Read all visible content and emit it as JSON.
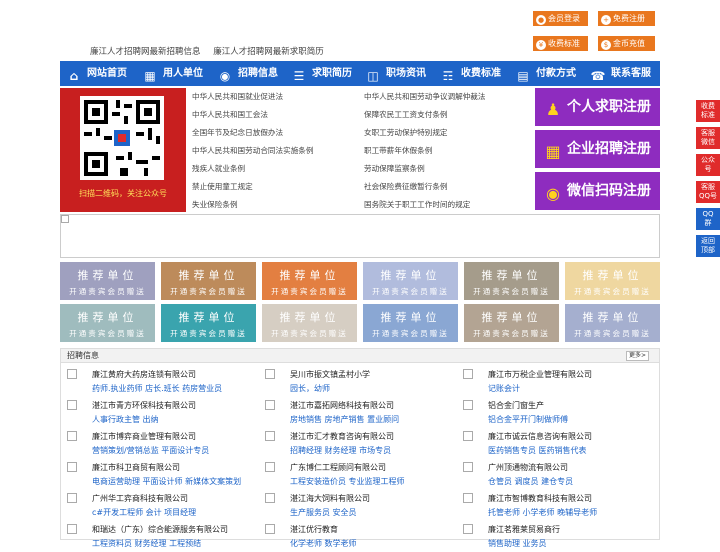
{
  "top_buttons": [
    {
      "label": "会员登录",
      "icon": "user-icon"
    },
    {
      "label": "免费注册",
      "icon": "user-add-icon"
    },
    {
      "label": "收费标准",
      "icon": "tag-icon"
    },
    {
      "label": "金币充值",
      "icon": "coin-icon"
    }
  ],
  "header_links": [
    "廉江人才招聘网最新招聘信息",
    "廉江人才招聘网最新求职简历"
  ],
  "nav": [
    {
      "label": "网站首页",
      "icon": "home-icon"
    },
    {
      "label": "用人单位",
      "icon": "building-icon"
    },
    {
      "label": "招聘信息",
      "icon": "megaphone-icon"
    },
    {
      "label": "求职简历",
      "icon": "resume-icon"
    },
    {
      "label": "职场资讯",
      "icon": "news-icon"
    },
    {
      "label": "收费标准",
      "icon": "fee-icon"
    },
    {
      "label": "付款方式",
      "icon": "payment-icon"
    },
    {
      "label": "联系客服",
      "icon": "service-icon"
    }
  ],
  "qr_caption": "扫描二维码，关注公众号",
  "laws_left": [
    "中华人民共和国就业促进法",
    "中华人民共和国工会法",
    "全国年节及纪念日放假办法",
    "中华人民共和国劳动合同法实施条例",
    "残疾人就业条例",
    "禁止使用童工规定",
    "失业保险条例"
  ],
  "laws_right": [
    "中华人民共和国劳动争议调解仲裁法",
    "保障农民工工资支付条例",
    "女职工劳动保护特别规定",
    "职工带薪年休假条例",
    "劳动保障监察条例",
    "社会保险费征缴暂行条例",
    "国务院关于职工工作时间的规定"
  ],
  "register": [
    {
      "label": "个人求职注册",
      "icon": "person-icon"
    },
    {
      "label": "企业招聘注册",
      "icon": "company-icon"
    },
    {
      "label": "微信扫码注册",
      "icon": "wechat-icon"
    }
  ],
  "tile_title": "推荐单位",
  "tile_sub": "开通贵宾会员赠送",
  "tile_colors": [
    "#9fa0bf",
    "#bd8b5b",
    "#e37f41",
    "#b1bcdd",
    "#a59c8b",
    "#efd7a0",
    "#9fbcbe",
    "#3aa4ae",
    "#d6cec3",
    "#8aa7d3",
    "#b3a493",
    "#a5afcf"
  ],
  "jobs_title": "招聘信息",
  "more_label": "更多>",
  "jobs": [
    {
      "name": "廉江黄府大药房连锁有限公司",
      "titles": "药师.执业药师 店长.班长 药房营业员"
    },
    {
      "name": "吴川市振文镇孟村小学",
      "titles": "园长，幼师"
    },
    {
      "name": "廉江市万税企业管理有限公司",
      "titles": "记账会计"
    },
    {
      "name": "湛江市青方环保科技有限公司",
      "titles": "人事行政主管 出纳"
    },
    {
      "name": "湛江市嘉拓网络科技有限公司",
      "titles": "房地销售 房地产销售 置业顾问"
    },
    {
      "name": "铝合金门窗生产",
      "titles": "铝合金平开门制做师傅"
    },
    {
      "name": "廉江市博弈商业管理有限公司",
      "titles": "营销策划/营销总监 平面设计专员"
    },
    {
      "name": "湛江市汇才教育咨询有限公司",
      "titles": "招聘经理 财务经理 市场专员"
    },
    {
      "name": "廉江市诚云信息咨询有限公司",
      "titles": "医药销售专员 医药销售代表"
    },
    {
      "name": "廉江市科卫商贸有限公司",
      "titles": "电商运营助理 平面设计师 新媒体文案策划"
    },
    {
      "name": "广东博仁工程顾问有限公司",
      "titles": "工程安装造价员 专业监理工程师"
    },
    {
      "name": "广州顶通物流有限公司",
      "titles": "仓管员 调度员 建仓专员"
    },
    {
      "name": "广州华工弈商科技有限公司",
      "titles": "c#开发工程师 会计 项目经理"
    },
    {
      "name": "湛江海大饲料有限公司",
      "titles": "生产服务员 安全员"
    },
    {
      "name": "廉江市智博教育科技有限公司",
      "titles": "托管老师 小学老师 晚辅导老师"
    },
    {
      "name": "和瑞达（广东）综合能源服务有限公司",
      "titles": "工程资料员 财务经理 工程预结"
    },
    {
      "name": "湛江优行教育",
      "titles": "化学老师 数学老师"
    },
    {
      "name": "廉江茗雅莱贸易商行",
      "titles": "销售助理 业务员"
    }
  ],
  "side": [
    {
      "l1": "收费",
      "l2": "标准",
      "color": "#e02b2b"
    },
    {
      "l1": "客服",
      "l2": "微信",
      "color": "#e02b2b"
    },
    {
      "l1": "公众",
      "l2": "号",
      "color": "#e02b2b"
    },
    {
      "l1": "客服",
      "l2": "QQ号",
      "color": "#e02b2b"
    },
    {
      "l1": "QQ",
      "l2": "群",
      "color": "#1e64c8"
    },
    {
      "l1": "返回",
      "l2": "顶部",
      "color": "#1e64c8"
    }
  ]
}
